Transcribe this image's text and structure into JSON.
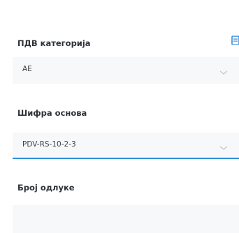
{
  "fields": {
    "vat_category": {
      "label": "ПДВ категорија",
      "value": "AE"
    },
    "basis_code": {
      "label": "Шифра основа",
      "value": "PDV-RS-10-2-3"
    },
    "decision_number": {
      "label": "Број одлуке",
      "value": ""
    }
  },
  "colors": {
    "accent": "#2f8fd8",
    "field_background": "#f7f8fa"
  },
  "icons": {
    "corner": "document-icon",
    "dropdown": "chevron-down-icon"
  }
}
